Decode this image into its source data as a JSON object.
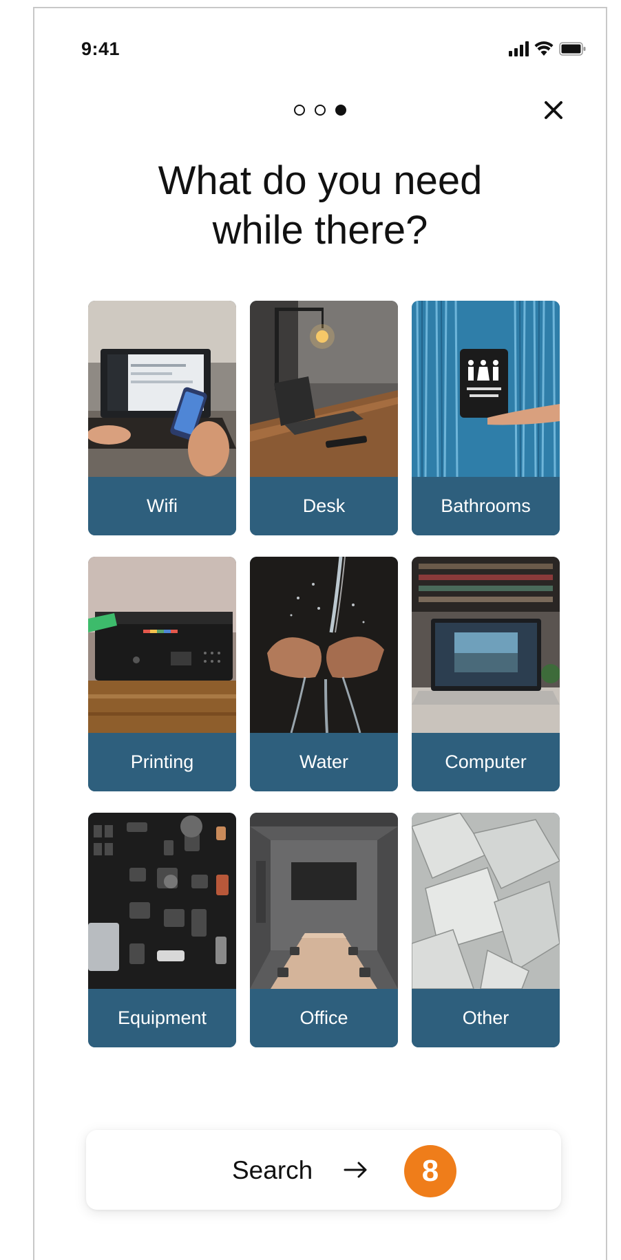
{
  "status_bar": {
    "time": "9:41"
  },
  "pager": {
    "total": 3,
    "active_index": 2
  },
  "title": {
    "line1": "What do you need",
    "line2": "while there?"
  },
  "tiles": [
    {
      "label": "Wifi",
      "image": "laptop-phone-photo"
    },
    {
      "label": "Desk",
      "image": "desk-lamp-photo"
    },
    {
      "label": "Bathrooms",
      "image": "restroom-sign-photo"
    },
    {
      "label": "Printing",
      "image": "printer-photo"
    },
    {
      "label": "Water",
      "image": "hands-water-photo"
    },
    {
      "label": "Computer",
      "image": "laptop-desk-photo"
    },
    {
      "label": "Equipment",
      "image": "gear-flatlay-photo"
    },
    {
      "label": "Office",
      "image": "conference-room-photo"
    },
    {
      "label": "Other",
      "image": "paper-sheets-photo"
    }
  ],
  "search_button": {
    "label": "Search",
    "badge": "8"
  },
  "colors": {
    "tile_label_bg": "#2e5f7d",
    "badge_bg": "#ef7d1a"
  }
}
